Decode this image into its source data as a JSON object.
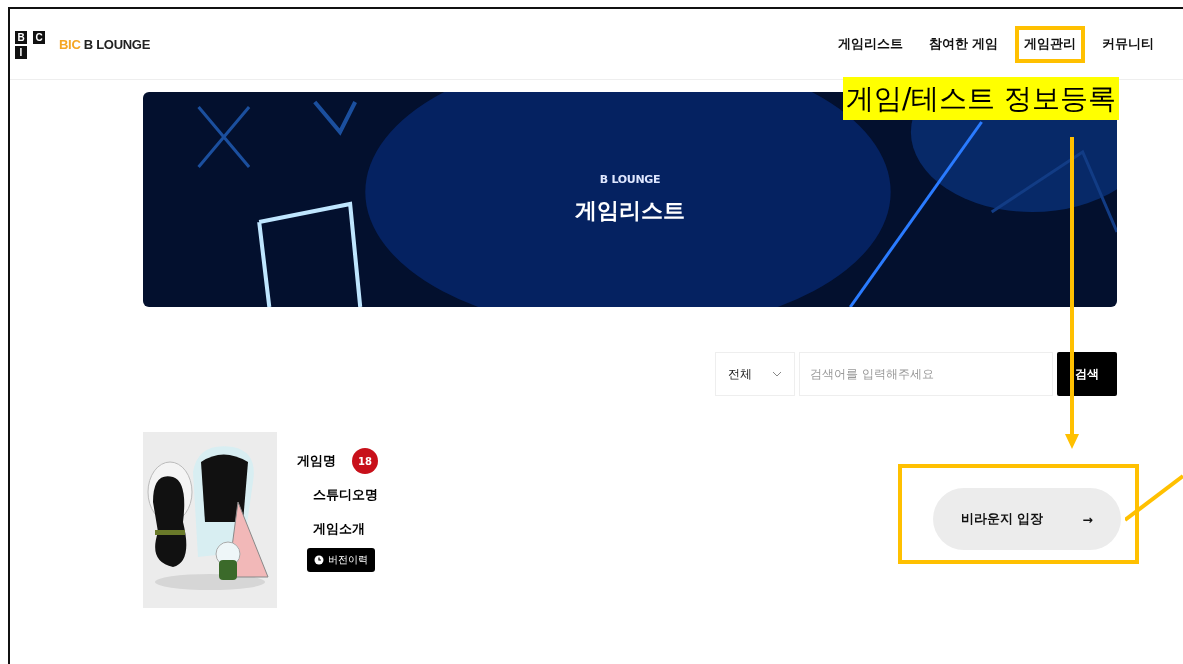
{
  "logo": {
    "letters": [
      "B",
      "C",
      "I"
    ],
    "accent": "BIC",
    "name": "B LOUNGE"
  },
  "nav": [
    {
      "label": "게임리스트",
      "highlighted": false
    },
    {
      "label": "참여한 게임",
      "highlighted": false
    },
    {
      "label": "게임관리",
      "highlighted": true
    },
    {
      "label": "커뮤니티",
      "highlighted": false
    }
  ],
  "annotation": {
    "label": "게임/테스트 정보등록"
  },
  "banner": {
    "eyebrow": "B LOUNGE",
    "title": "게임리스트"
  },
  "search": {
    "category": "전체",
    "placeholder": "검색어를 입력해주세요",
    "button": "검색"
  },
  "game": {
    "name": "게임명",
    "age_badge": "18",
    "studio": "스튜디오명",
    "intro": "게임소개",
    "version_button": "버전이력"
  },
  "enter_button": {
    "label": "비라운지 입장",
    "arrow": "→",
    "highlighted": true
  }
}
